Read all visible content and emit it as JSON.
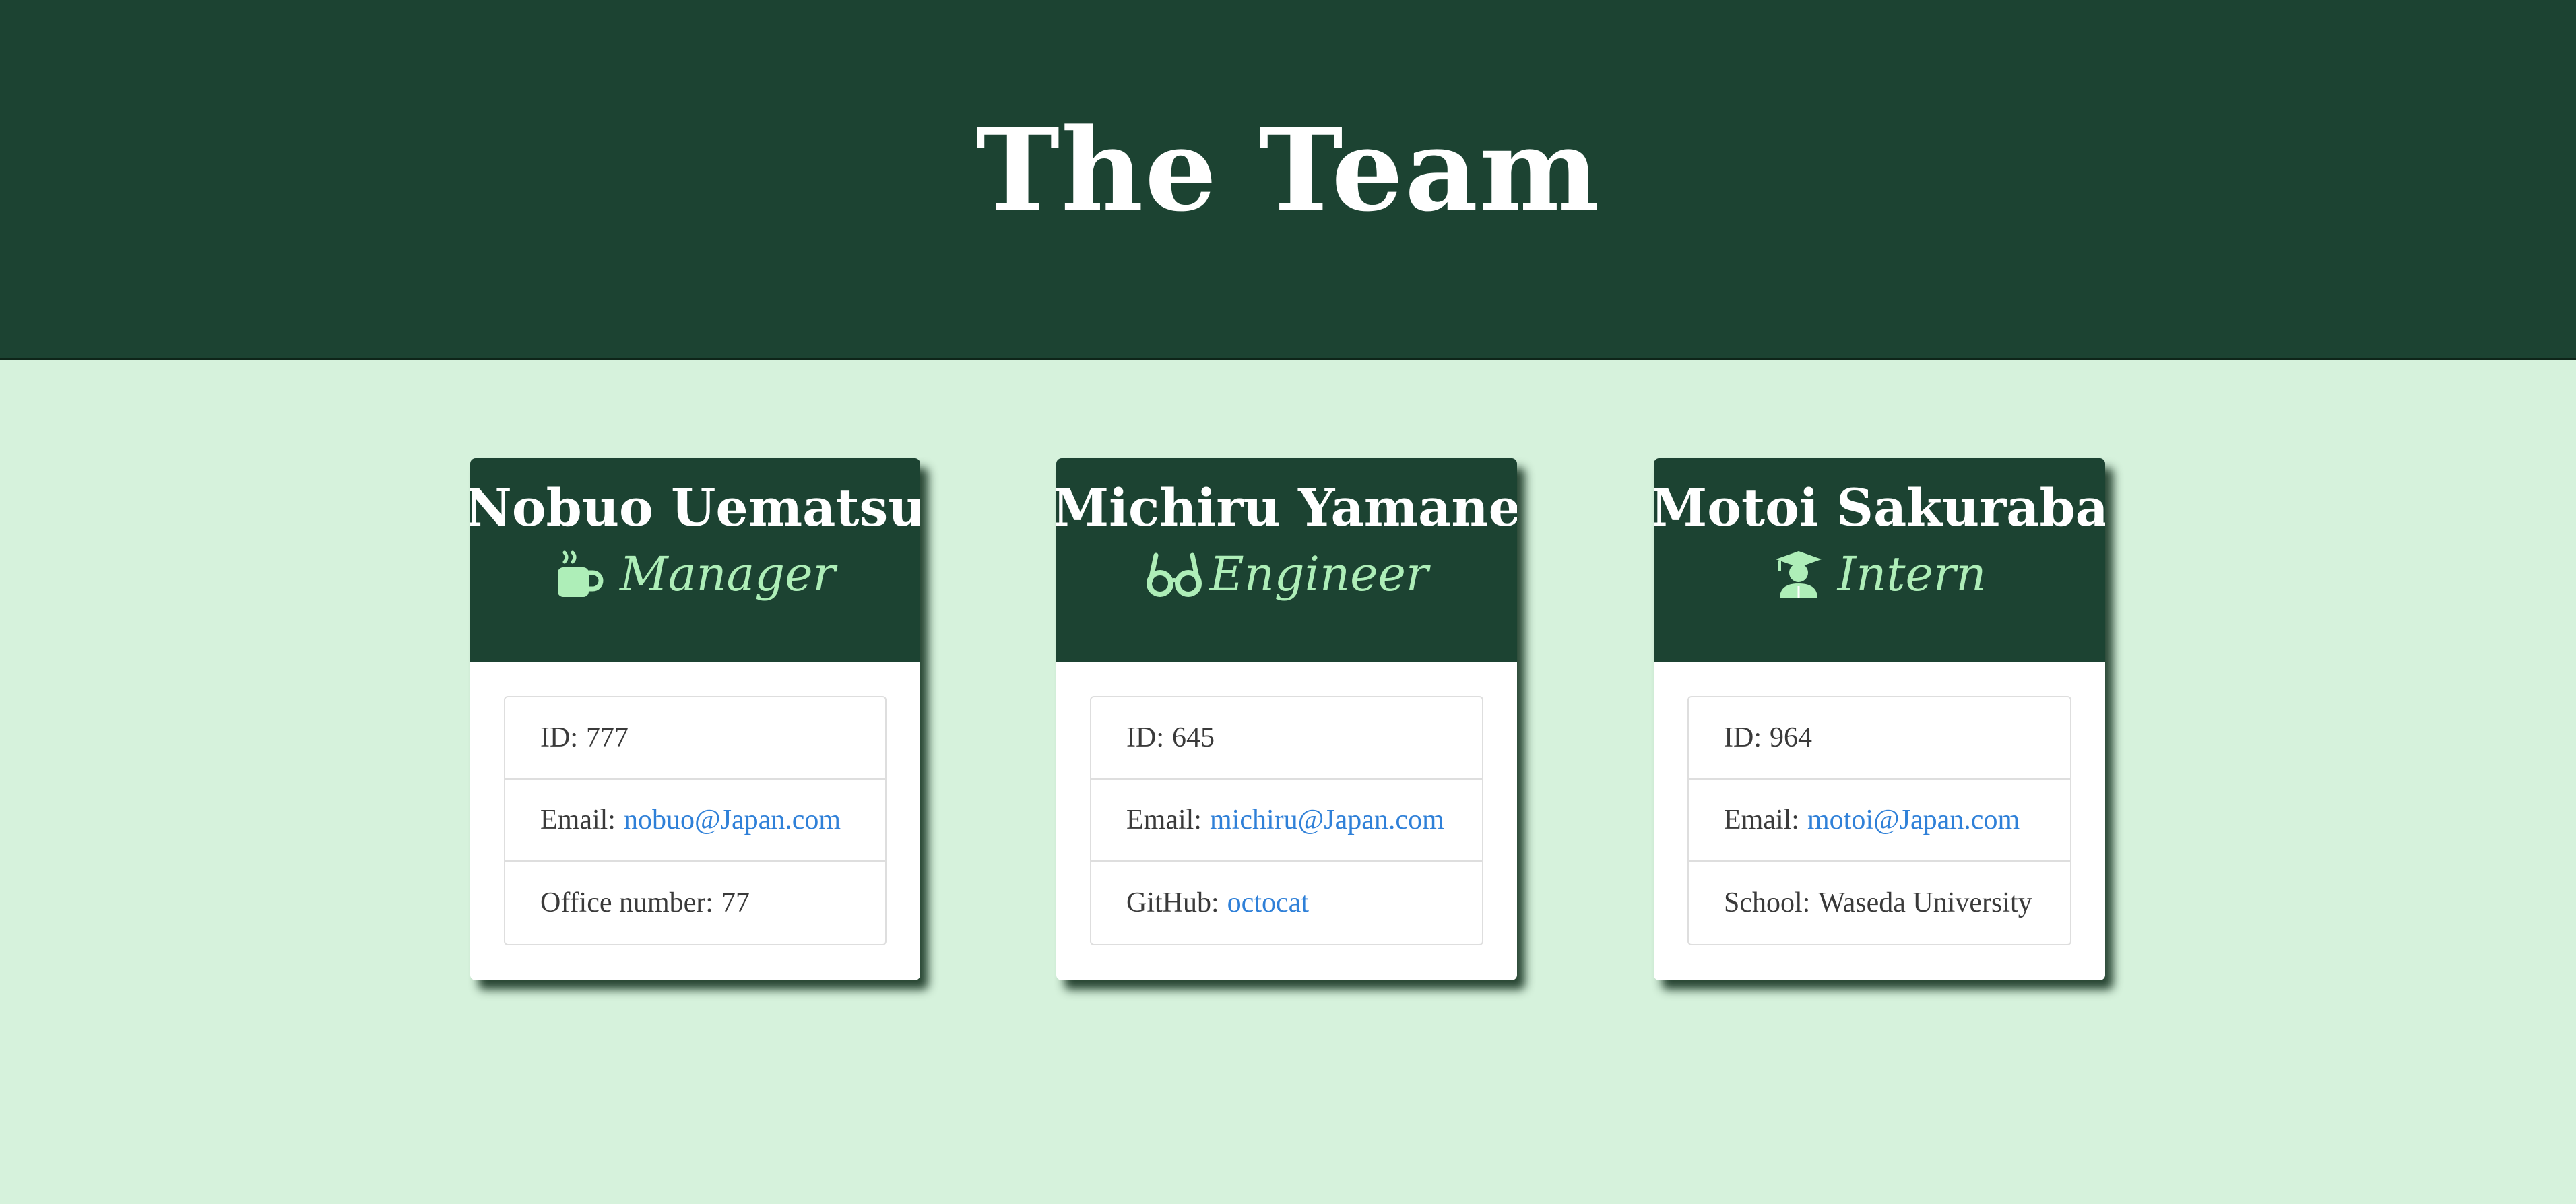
{
  "header": {
    "title": "The Team"
  },
  "colors": {
    "header_bg": "#1c4332",
    "page_bg": "#d6f2dc",
    "role_accent": "#aeeeb8",
    "link": "#2f80d8"
  },
  "cards": [
    {
      "name": "Nobuo Uematsu",
      "role": "Manager",
      "role_icon": "coffee-mug-icon",
      "items": [
        {
          "label": "ID:",
          "value": "777"
        },
        {
          "label": "Email:",
          "value": "nobuo@Japan.com"
        },
        {
          "label": "Office number:",
          "value": "77"
        }
      ]
    },
    {
      "name": "Michiru Yamane",
      "role": "Engineer",
      "role_icon": "glasses-icon",
      "items": [
        {
          "label": "ID:",
          "value": "645"
        },
        {
          "label": "Email:",
          "value": "michiru@Japan.com"
        },
        {
          "label": "GitHub:",
          "value": "octocat"
        }
      ]
    },
    {
      "name": "Motoi Sakuraba",
      "role": "Intern",
      "role_icon": "graduate-icon",
      "items": [
        {
          "label": "ID:",
          "value": "964"
        },
        {
          "label": "Email:",
          "value": "motoi@Japan.com"
        },
        {
          "label": "School:",
          "value": "Waseda University"
        }
      ]
    }
  ]
}
